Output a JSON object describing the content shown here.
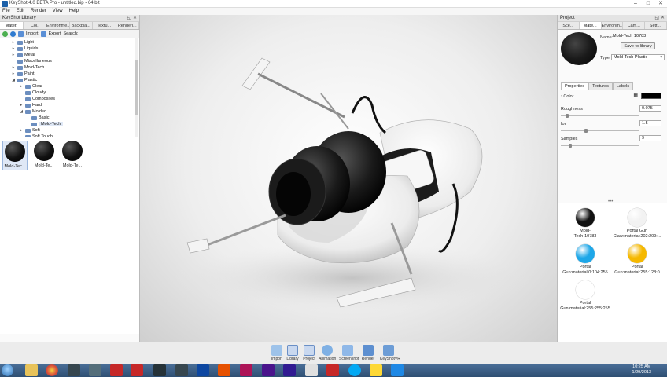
{
  "window": {
    "title": "KeyShot 4.0 BETA Pro - untitled.bip - 64 bit"
  },
  "menu": [
    "File",
    "Edit",
    "Render",
    "View",
    "Help"
  ],
  "library": {
    "header": "KeyShot Library",
    "tabs": [
      "Mater.",
      "Col.",
      "Environme...",
      "Backpla...",
      "Textu...",
      "Renderi..."
    ],
    "toolbar": {
      "import": "Import",
      "export": "Export",
      "search": "Search:"
    },
    "tree": [
      {
        "label": "Light",
        "depth": 1,
        "state": "collapsed"
      },
      {
        "label": "Liquids",
        "depth": 1,
        "state": "collapsed"
      },
      {
        "label": "Metal",
        "depth": 1,
        "state": "collapsed"
      },
      {
        "label": "Miscellaneous",
        "depth": 1,
        "state": "none"
      },
      {
        "label": "Mold-Tech",
        "depth": 1,
        "state": "collapsed"
      },
      {
        "label": "Paint",
        "depth": 1,
        "state": "collapsed"
      },
      {
        "label": "Plastic",
        "depth": 1,
        "state": "expanded"
      },
      {
        "label": "Clear",
        "depth": 2,
        "state": "collapsed"
      },
      {
        "label": "Cloudy",
        "depth": 2,
        "state": "none"
      },
      {
        "label": "Composites",
        "depth": 2,
        "state": "none"
      },
      {
        "label": "Hard",
        "depth": 2,
        "state": "collapsed"
      },
      {
        "label": "Molded",
        "depth": 2,
        "state": "expanded"
      },
      {
        "label": "Basic",
        "depth": 3,
        "state": "none"
      },
      {
        "label": "Mold-Tech",
        "depth": 3,
        "state": "selected"
      },
      {
        "label": "Soft",
        "depth": 2,
        "state": "collapsed"
      },
      {
        "label": "Soft Touch",
        "depth": 2,
        "state": "none"
      }
    ],
    "thumbnails": [
      "Mold-Tec...",
      "Mold-Te...",
      "Mold-Te..."
    ]
  },
  "project": {
    "header": "Project",
    "tabs": [
      "Sce...",
      "Mate...",
      "Environm...",
      "Cam...",
      "Setti..."
    ],
    "name_label": "Name:",
    "name_value": "Mold-Tech 10783",
    "save_button": "Save to library",
    "type_label": "Type:",
    "type_value": "Mold-Tech Plastic",
    "subtabs": [
      "Properties",
      "Textures",
      "Labels"
    ],
    "properties": {
      "color_label": "Color",
      "roughness_label": "Roughness",
      "roughness_value": "0.075",
      "roughness_fraction": 0.06,
      "ior_label": "Ior",
      "ior_value": "1.5",
      "ior_fraction": 0.3,
      "samples_label": "Samples",
      "samples_value": "9",
      "samples_fraction": 0.1
    },
    "materials": [
      {
        "line1": "Mold-",
        "line2": "Tech-10783",
        "color": "#111111"
      },
      {
        "line1": "Portal Gun",
        "line2": "Claw:material:202:209:...",
        "color": "#f2f2f2"
      },
      {
        "line1": "Portal",
        "line2": "Gun:material:0:104:255",
        "color": "#1ea7e8"
      },
      {
        "line1": "Portal",
        "line2": "Gun:material:255:128:0",
        "color": "#f5b800"
      },
      {
        "line1": "Portal",
        "line2": "Gun:material:255:255:255",
        "color": "#ffffff"
      }
    ]
  },
  "dock": [
    "Import",
    "Library",
    "Project",
    "Animation",
    "Screenshot",
    "Render",
    "KeyShotVR"
  ],
  "taskbar": {
    "time": "10:25 AM",
    "date": "1/29/2013"
  }
}
